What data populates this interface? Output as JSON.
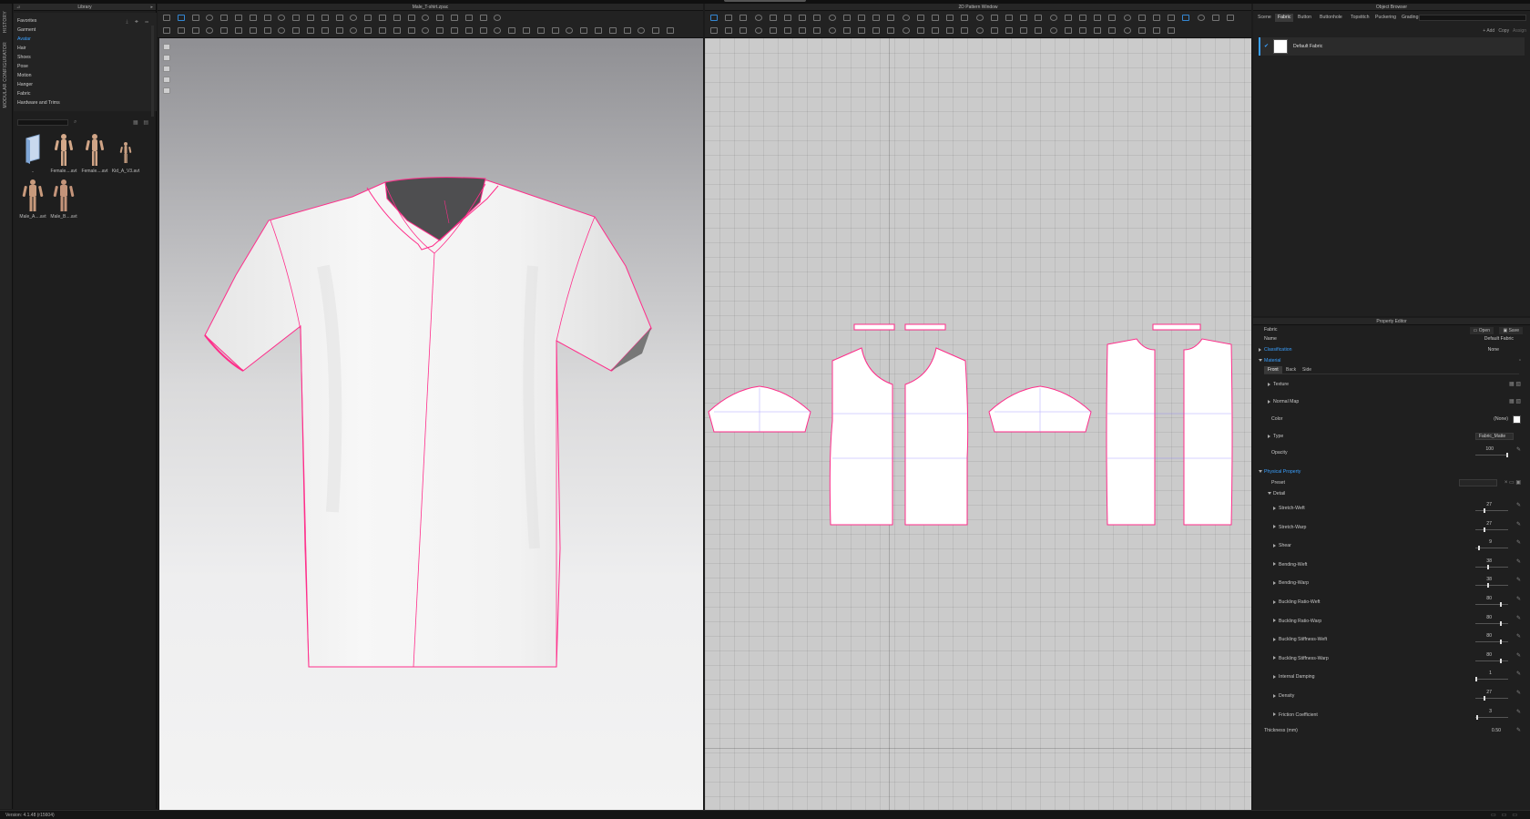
{
  "app": {
    "side_tabs": [
      "HISTORY",
      "MODULAR CONFIGURATOR"
    ],
    "version": "Version: 4.1.48 (r15604)"
  },
  "library": {
    "title": "Library",
    "categories": [
      "Favorites",
      "Garment",
      "Avatar",
      "Hair",
      "Shoes",
      "Pose",
      "Motion",
      "Hanger",
      "Fabric",
      "Hardware and Trims"
    ],
    "active_category": "Avatar",
    "thumbnails": [
      {
        "label": "..",
        "icon": "folder-up-icon"
      },
      {
        "label": "Female....avt",
        "icon": "avatar-female-icon"
      },
      {
        "label": "Female....avt",
        "icon": "avatar-female-icon"
      },
      {
        "label": "Kid_A_V3.avt",
        "icon": "avatar-kid-icon"
      },
      {
        "label": "Male_A....avt",
        "icon": "avatar-male-icon"
      },
      {
        "label": "Male_B....avt",
        "icon": "avatar-male-icon"
      }
    ]
  },
  "viewport3d": {
    "title": "Male_T-shirt.zpac"
  },
  "pattern2d": {
    "title": "2D Pattern Window"
  },
  "object_browser": {
    "title": "Object Browser",
    "tabs": [
      "Scene",
      "Fabric",
      "Button",
      "Buttonhole",
      "Topstitch",
      "Puckering",
      "Grading"
    ],
    "active_tab": "Fabric",
    "actions": {
      "add": "+ Add",
      "copy": "Copy",
      "assign": "Assign"
    },
    "items": [
      {
        "name": "Default Fabric"
      }
    ]
  },
  "property_editor": {
    "title": "Property Editor",
    "object_type": "Fabric",
    "open_label": "Open",
    "save_label": "Save",
    "name_label": "Name",
    "name_value": "Default Fabric",
    "classification_label": "Classification",
    "classification_value": "None",
    "material_label": "Material",
    "material_tabs": [
      "Front",
      "Back",
      "Side"
    ],
    "texture_label": "Texture",
    "normal_map_label": "Normal Map",
    "color_label": "Color",
    "color_value": "(None)",
    "type_label": "Type",
    "type_value": "Fabric_Matte",
    "opacity_label": "Opacity",
    "opacity_value": "100",
    "physical_label": "Physical Property",
    "preset_label": "Preset",
    "detail_label": "Detail",
    "params": [
      {
        "name": "Stretch-Weft",
        "value": "27",
        "fraction": 0.27
      },
      {
        "name": "Stretch-Warp",
        "value": "27",
        "fraction": 0.27
      },
      {
        "name": "Shear",
        "value": "9",
        "fraction": 0.09
      },
      {
        "name": "Bending-Weft",
        "value": "38",
        "fraction": 0.38
      },
      {
        "name": "Bending-Warp",
        "value": "38",
        "fraction": 0.38
      },
      {
        "name": "Buckling Ratio-Weft",
        "value": "80",
        "fraction": 0.8
      },
      {
        "name": "Buckling Ratio-Warp",
        "value": "80",
        "fraction": 0.8
      },
      {
        "name": "Buckling Stiffness-Weft",
        "value": "80",
        "fraction": 0.8
      },
      {
        "name": "Buckling Stiffness-Warp",
        "value": "80",
        "fraction": 0.8
      },
      {
        "name": "Internal Damping",
        "value": "1",
        "fraction": 0.01
      },
      {
        "name": "Density",
        "value": "27",
        "fraction": 0.27
      },
      {
        "name": "Friction Coefficient",
        "value": "3",
        "fraction": 0.03
      }
    ],
    "thickness_label": "Thickness (mm)",
    "thickness_value": "0.50"
  },
  "colors": {
    "accent": "#3aa0ff",
    "seam": "#ff2d8a",
    "panel_bg": "#1f1f1f",
    "pattern_bg": "#cbcbcb"
  }
}
